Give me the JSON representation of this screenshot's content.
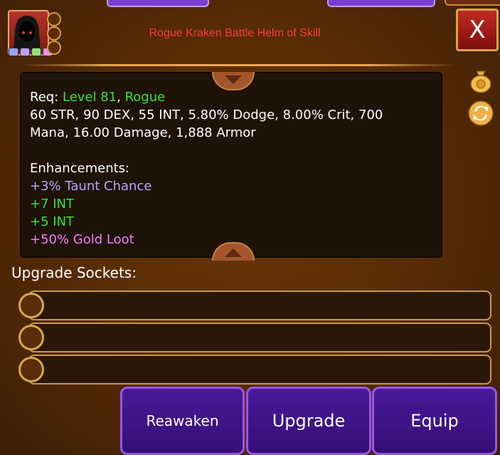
{
  "item": {
    "title": "Rogue Kraken Battle Helm of Skill",
    "close_label": "X"
  },
  "stats": {
    "req_prefix": "Req: ",
    "req_level": "Level 81",
    "req_sep": ", ",
    "req_class": "Rogue",
    "line2": "60 STR, 90 DEX, 55 INT, 5.80% Dodge, 8.00% Crit, 700",
    "line3": "Mana, 16.00 Damage, 1,888 Armor",
    "enh_header": "Enhancements:",
    "enh": [
      "+3% Taunt Chance",
      "+7 INT",
      "+5 INT",
      "+50% Gold Loot"
    ]
  },
  "sockets": {
    "label": "Upgrade Sockets:",
    "count": 3
  },
  "buttons": {
    "reawaken": "Reawaken",
    "upgrade": "Upgrade",
    "equip": "Equip"
  },
  "icons": {
    "side": [
      "gold-bag-icon",
      "swap-icon"
    ],
    "avatar": "hooded-rogue-icon"
  },
  "colors": {
    "title": "#ff3a3a",
    "green": "#33e633",
    "taunt": "#b3a6ff",
    "gold_loot": "#f07dff",
    "button": "#4a1a9a"
  }
}
